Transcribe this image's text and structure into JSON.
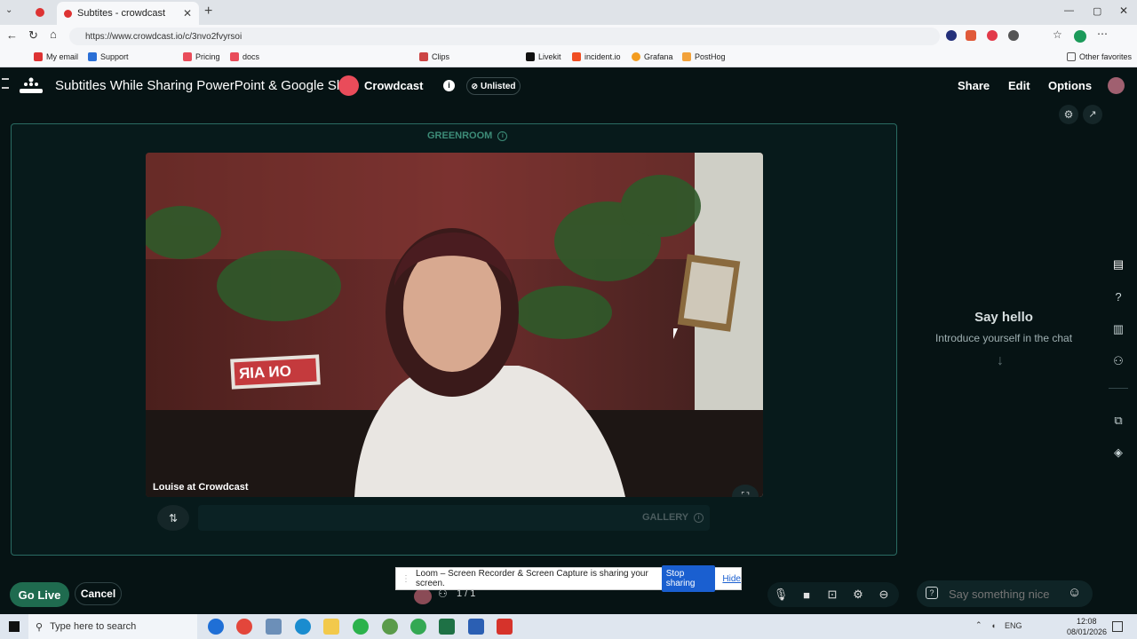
{
  "browser": {
    "tab_title": "Subtites - crowdcast",
    "url": "https://www.crowdcast.io/c/3nvo2fvyrsoi"
  },
  "bookmarks": [
    "My email",
    "Support",
    "Pricing",
    "docs",
    "Clips",
    "Livekit",
    "incident.io",
    "Grafana",
    "PostHog"
  ],
  "other_favorites": "Other favorites",
  "header": {
    "event_title": "Subtitles While Sharing PowerPoint & Google Slide",
    "brand": "Crowdcast",
    "unlisted": "Unlisted",
    "share": "Share",
    "edit": "Edit",
    "options": "Options"
  },
  "stage": {
    "label": "GREENROOM",
    "speaker": "Louise at Crowdcast",
    "gallery": "GALLERY",
    "sign": "ON AIR"
  },
  "chat": {
    "title": "Say hello",
    "subtitle": "Introduce yourself in the chat",
    "placeholder": "Say something nice"
  },
  "controls": {
    "go_live": "Go Live",
    "cancel": "Cancel",
    "count": "1 / 1"
  },
  "loom": {
    "message": "Loom – Screen Recorder & Screen Capture is sharing your screen.",
    "stop": "Stop sharing",
    "hide": "Hide"
  },
  "taskbar": {
    "search": "Type here to search",
    "lang": "ENG",
    "time": "12:08",
    "date": "08/01/2026"
  },
  "colors": {
    "accent": "#2a6b63",
    "golive": "#1f6b4f",
    "brand": "#e94c5a",
    "loom_blue": "#1a5fd0"
  }
}
